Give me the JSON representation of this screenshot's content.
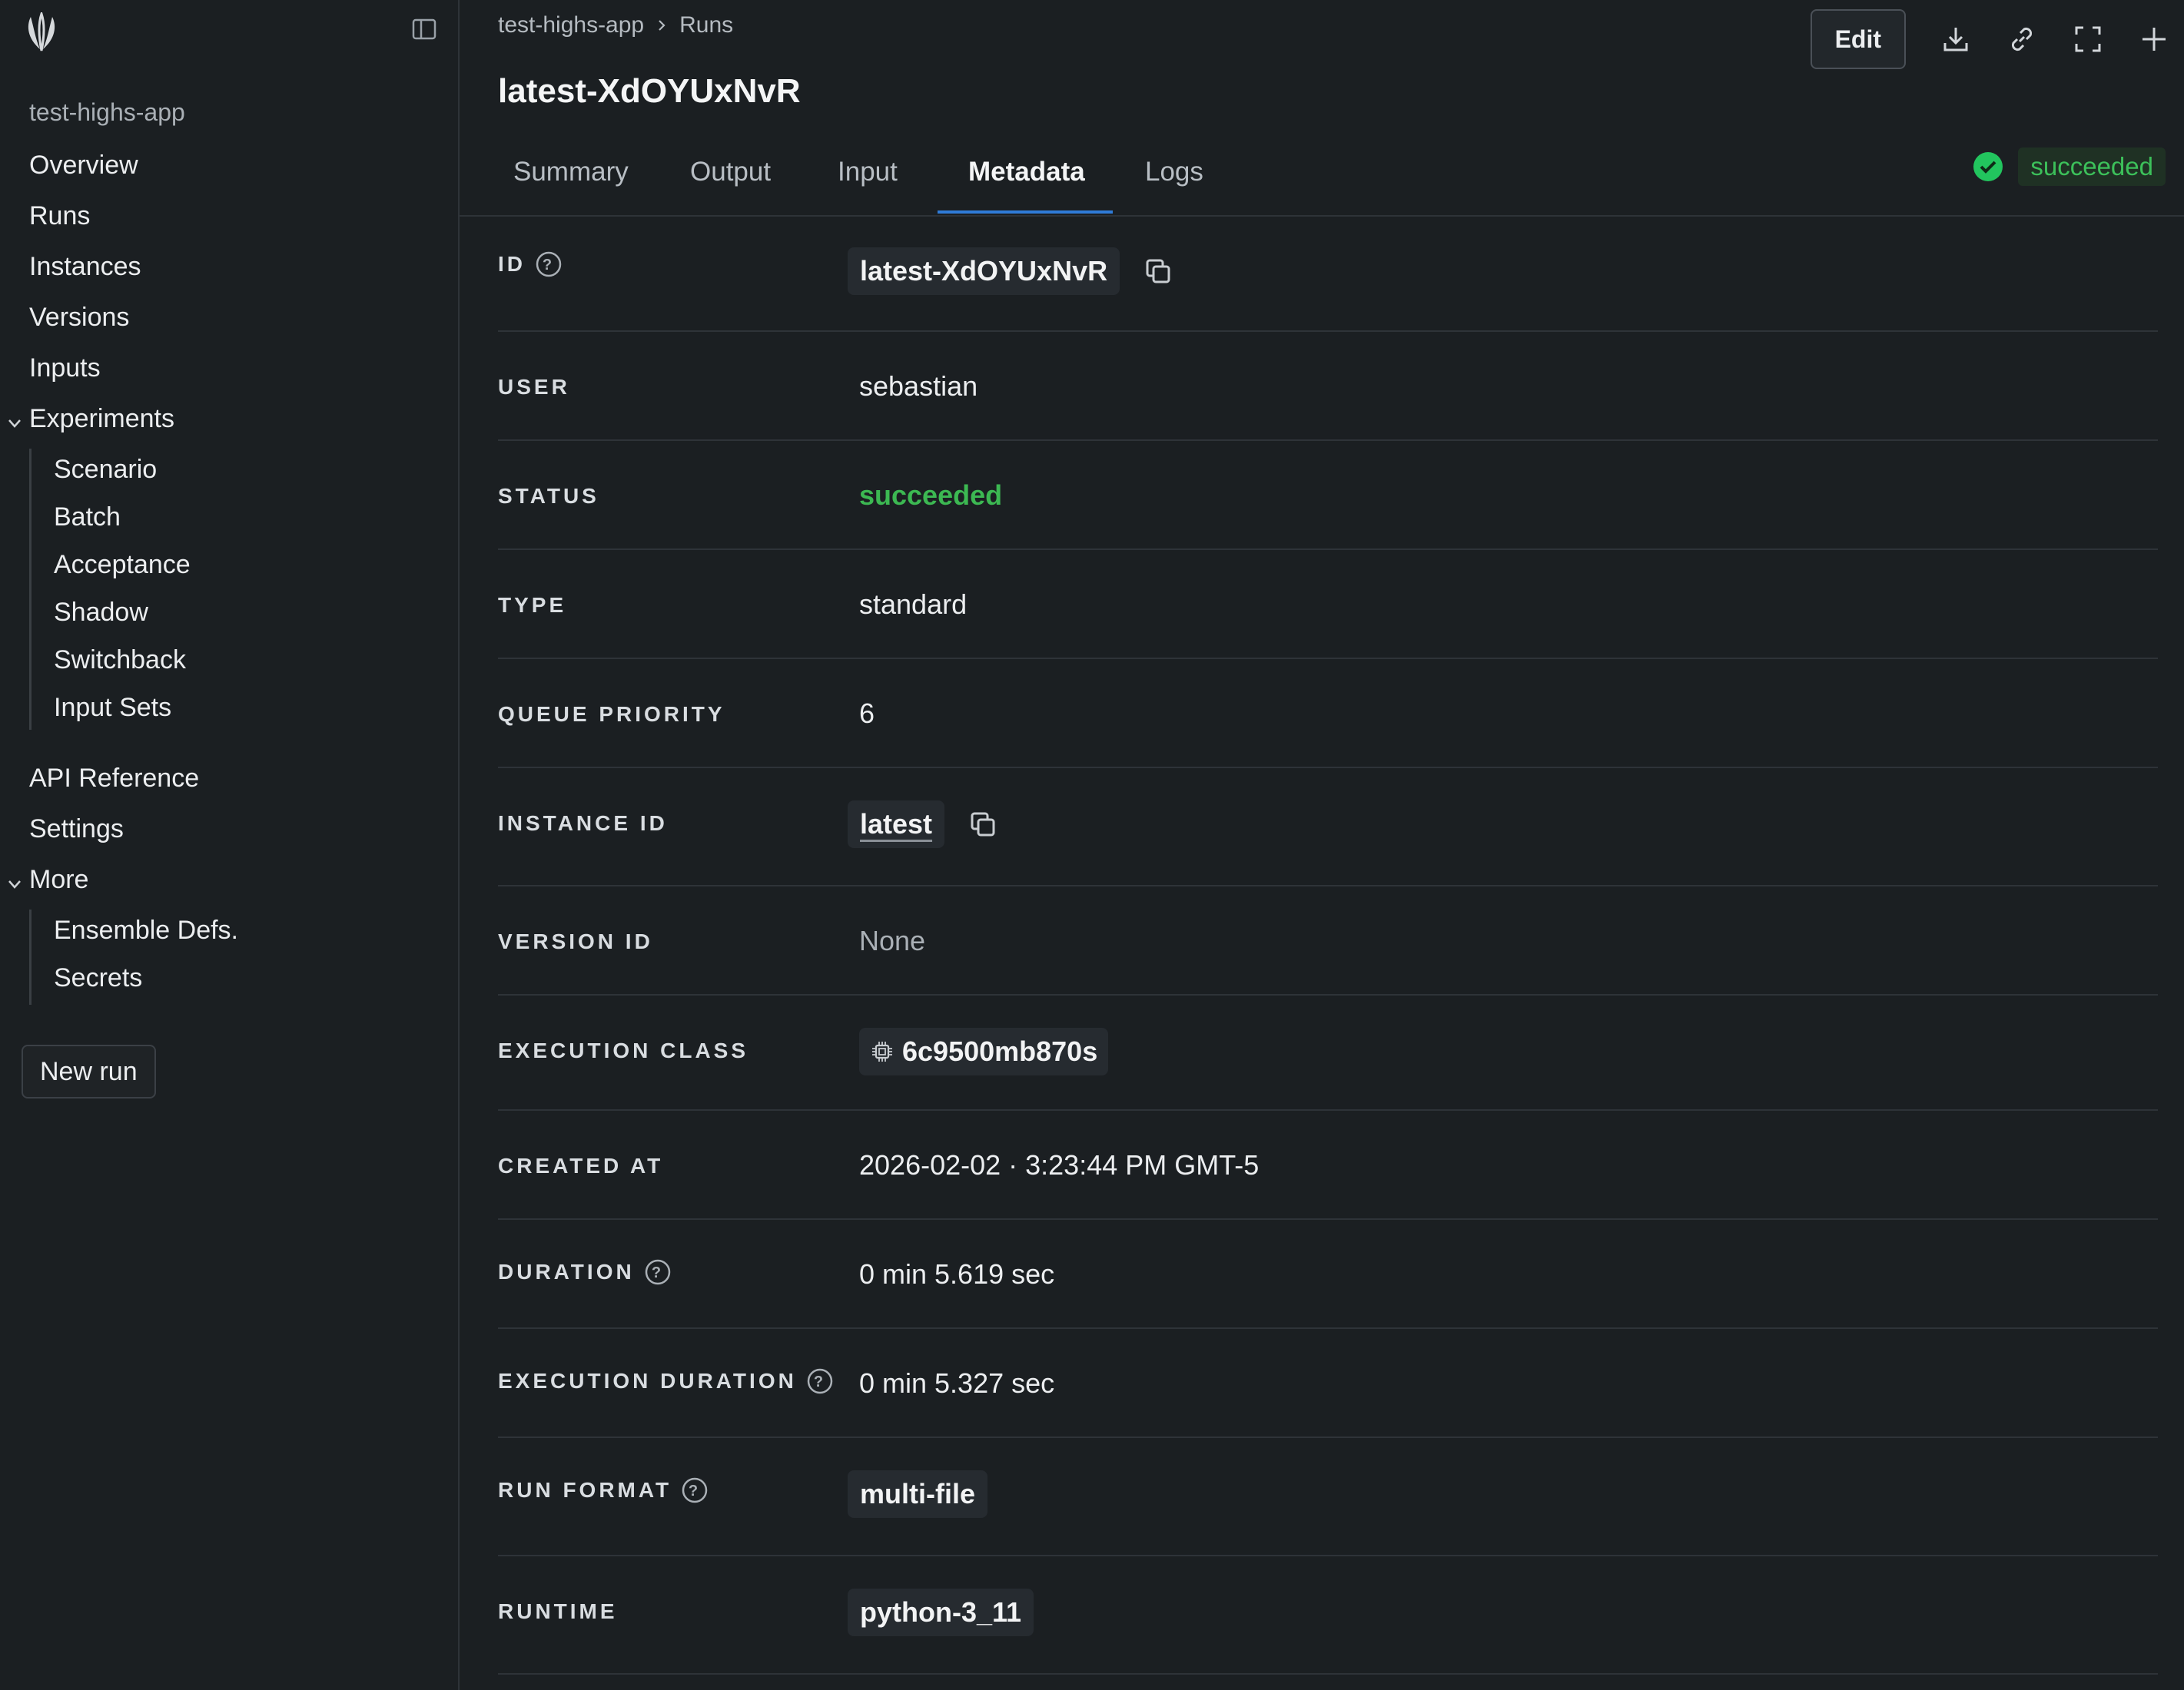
{
  "sidebar": {
    "app_name": "test-highs-app",
    "items": [
      {
        "label": "Overview"
      },
      {
        "label": "Runs"
      },
      {
        "label": "Instances"
      },
      {
        "label": "Versions"
      },
      {
        "label": "Inputs"
      },
      {
        "label": "Experiments"
      },
      {
        "label": "API Reference"
      },
      {
        "label": "Settings"
      },
      {
        "label": "More"
      }
    ],
    "experiments_sub": [
      {
        "label": "Scenario"
      },
      {
        "label": "Batch"
      },
      {
        "label": "Acceptance"
      },
      {
        "label": "Shadow"
      },
      {
        "label": "Switchback"
      },
      {
        "label": "Input Sets"
      }
    ],
    "more_sub": [
      {
        "label": "Ensemble Defs."
      },
      {
        "label": "Secrets"
      }
    ],
    "new_run_label": "New run"
  },
  "header": {
    "breadcrumb": [
      "test-highs-app",
      "Runs"
    ],
    "title": "latest-XdOYUxNvR",
    "edit_label": "Edit",
    "tools": [
      "download-icon",
      "link-icon",
      "fullscreen-icon",
      "plus-icon"
    ]
  },
  "tabs": [
    {
      "label": "Summary"
    },
    {
      "label": "Output"
    },
    {
      "label": "Input"
    },
    {
      "label": "Metadata",
      "active": true
    },
    {
      "label": "Logs"
    }
  ],
  "status": {
    "label": "succeeded",
    "color": "#3cc05a"
  },
  "metadata": {
    "id": {
      "label": "ID",
      "value": "latest-XdOYUxNvR"
    },
    "user": {
      "label": "USER",
      "value": "sebastian"
    },
    "status": {
      "label": "STATUS",
      "value": "succeeded"
    },
    "type": {
      "label": "TYPE",
      "value": "standard"
    },
    "queue_priority": {
      "label": "QUEUE PRIORITY",
      "value": "6"
    },
    "instance_id": {
      "label": "INSTANCE ID",
      "value": "latest"
    },
    "version_id": {
      "label": "VERSION ID",
      "value": "None"
    },
    "execution_class": {
      "label": "EXECUTION CLASS",
      "value": "6c9500mb870s"
    },
    "created_at": {
      "label": "CREATED AT",
      "value": "2026-02-02 · 3:23:44 PM GMT-5"
    },
    "duration": {
      "label": "DURATION",
      "value": "0 min 5.619 sec"
    },
    "execution_duration": {
      "label": "EXECUTION DURATION",
      "value": "0 min 5.327 sec"
    },
    "run_format": {
      "label": "RUN FORMAT",
      "value": "multi-file"
    },
    "runtime": {
      "label": "RUNTIME",
      "value": "python-3_11"
    }
  },
  "colors": {
    "accent": "#2f7bd8",
    "success": "#3cb852",
    "background": "#1b1f22"
  }
}
